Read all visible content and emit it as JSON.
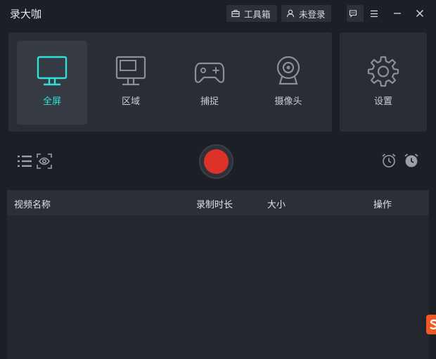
{
  "app": {
    "title": "录大咖"
  },
  "titlebar": {
    "toolbox_label": "工具箱",
    "login_label": "未登录"
  },
  "modes": [
    {
      "label": "全屏",
      "icon": "monitor-icon",
      "active": true
    },
    {
      "label": "区域",
      "icon": "region-monitor-icon",
      "active": false
    },
    {
      "label": "捕捉",
      "icon": "gamepad-icon",
      "active": false
    },
    {
      "label": "摄像头",
      "icon": "webcam-icon",
      "active": false
    }
  ],
  "settings": {
    "label": "设置",
    "icon": "gear-icon"
  },
  "table": {
    "columns": [
      "视频名称",
      "录制时长",
      "大小",
      "操作"
    ],
    "rows": []
  },
  "colors": {
    "accent": "#2fe0d8",
    "record": "#dc3227",
    "background": "#1c1f25",
    "panel": "#292d35",
    "badge": "#f05a22"
  }
}
